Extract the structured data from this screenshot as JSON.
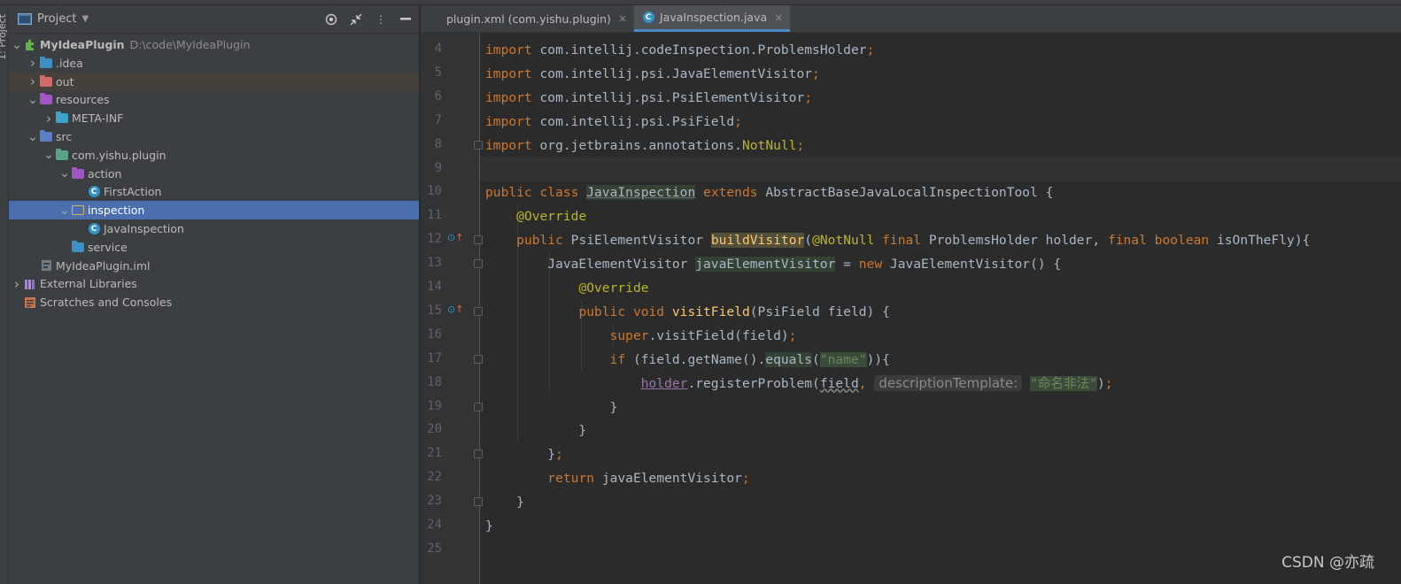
{
  "sidebar_stripe_label": "1: Project",
  "project_panel": {
    "title": "Project",
    "tree": [
      {
        "depth": 0,
        "expanded": true,
        "icon": "plugin-module-icon",
        "label": "MyIdeaPlugin",
        "path": "D:\\code\\MyIdeaPlugin",
        "bold": true
      },
      {
        "depth": 1,
        "expanded": false,
        "icon": "folder-idea-icon",
        "label": ".idea"
      },
      {
        "depth": 1,
        "expanded": false,
        "icon": "folder-out-icon",
        "label": "out",
        "style": "hl-out"
      },
      {
        "depth": 1,
        "expanded": true,
        "icon": "folder-resources-icon",
        "label": "resources"
      },
      {
        "depth": 2,
        "expanded": false,
        "icon": "folder-meta-icon",
        "label": "META-INF"
      },
      {
        "depth": 1,
        "expanded": true,
        "icon": "folder-src-icon",
        "label": "src"
      },
      {
        "depth": 2,
        "expanded": true,
        "icon": "package-icon",
        "label": "com.yishu.plugin"
      },
      {
        "depth": 3,
        "expanded": true,
        "icon": "package-action-icon",
        "label": "action"
      },
      {
        "depth": 4,
        "expanded": null,
        "icon": "class-icon",
        "label": "FirstAction"
      },
      {
        "depth": 3,
        "expanded": true,
        "icon": "folder-plain-icon",
        "label": "inspection",
        "style": "selected"
      },
      {
        "depth": 4,
        "expanded": null,
        "icon": "class-icon",
        "label": "JavaInspection"
      },
      {
        "depth": 3,
        "expanded": null,
        "icon": "package-service-icon",
        "label": "service"
      },
      {
        "depth": 1,
        "expanded": null,
        "icon": "iml-file-icon",
        "label": "MyIdeaPlugin.iml"
      },
      {
        "depth": 0,
        "expanded": false,
        "icon": "library-icon",
        "label": "External Libraries"
      },
      {
        "depth": 0,
        "expanded": null,
        "icon": "scratches-icon",
        "label": "Scratches and Consoles"
      }
    ]
  },
  "tabs": [
    {
      "label": "plugin.xml (com.yishu.plugin)",
      "icon": "plugin-xml-icon",
      "active": false
    },
    {
      "label": "JavaInspection.java",
      "icon": "class-icon",
      "active": true
    }
  ],
  "editor": {
    "lines": [
      {
        "n": "4",
        "tokens": [
          {
            "t": "import ",
            "c": "kw"
          },
          {
            "t": "com.intellij.codeInspection.ProblemsHolder",
            "c": "dim"
          },
          {
            "t": ";",
            "c": "kw"
          }
        ]
      },
      {
        "n": "5",
        "tokens": [
          {
            "t": "import ",
            "c": "kw"
          },
          {
            "t": "com.intellij.psi.JavaElementVisitor",
            "c": "dim"
          },
          {
            "t": ";",
            "c": "kw"
          }
        ]
      },
      {
        "n": "6",
        "tokens": [
          {
            "t": "import ",
            "c": "kw"
          },
          {
            "t": "com.intellij.psi.PsiElementVisitor",
            "c": "dim"
          },
          {
            "t": ";",
            "c": "kw"
          }
        ]
      },
      {
        "n": "7",
        "tokens": [
          {
            "t": "import ",
            "c": "kw"
          },
          {
            "t": "com.intellij.psi.PsiField",
            "c": "dim"
          },
          {
            "t": ";",
            "c": "kw"
          }
        ]
      },
      {
        "n": "8",
        "tokens": [
          {
            "t": "import ",
            "c": "kw"
          },
          {
            "t": "org.jetbrains.annotations.",
            "c": "dim"
          },
          {
            "t": "NotNull",
            "c": "an"
          },
          {
            "t": ";",
            "c": "kw"
          }
        ]
      },
      {
        "n": "9",
        "tokens": []
      },
      {
        "n": "10",
        "tokens": [
          {
            "t": "public class ",
            "c": "kw"
          },
          {
            "t": "JavaInspection",
            "c": "unused"
          },
          {
            "t": " extends ",
            "c": "kw"
          },
          {
            "t": "AbstractBaseJavaLocalInspectionTool {",
            "c": "dim"
          }
        ]
      },
      {
        "n": "11",
        "tokens": [
          {
            "t": "    ",
            "c": "dim"
          },
          {
            "t": "@Override",
            "c": "an"
          }
        ]
      },
      {
        "n": "12",
        "tokens": [
          {
            "t": "    ",
            "c": "dim"
          },
          {
            "t": "public ",
            "c": "kw"
          },
          {
            "t": "PsiElementVisitor ",
            "c": "dim"
          },
          {
            "t": "buildVisitor",
            "c": "fn hlbg2"
          },
          {
            "t": "(",
            "c": "dim"
          },
          {
            "t": "@NotNull ",
            "c": "an"
          },
          {
            "t": "final ",
            "c": "kw"
          },
          {
            "t": "ProblemsHolder holder, ",
            "c": "dim"
          },
          {
            "t": "final boolean ",
            "c": "kw"
          },
          {
            "t": "isOnTheFly){",
            "c": "dim"
          }
        ]
      },
      {
        "n": "13",
        "tokens": [
          {
            "t": "        JavaElementVisitor ",
            "c": "dim"
          },
          {
            "t": "javaElementVisitor",
            "c": "dim hlbg"
          },
          {
            "t": " = ",
            "c": "dim"
          },
          {
            "t": "new ",
            "c": "kw"
          },
          {
            "t": "JavaElementVisitor() {",
            "c": "dim"
          }
        ]
      },
      {
        "n": "14",
        "tokens": [
          {
            "t": "            ",
            "c": "dim"
          },
          {
            "t": "@Override",
            "c": "an"
          }
        ]
      },
      {
        "n": "15",
        "tokens": [
          {
            "t": "            ",
            "c": "dim"
          },
          {
            "t": "public void ",
            "c": "kw"
          },
          {
            "t": "visitField",
            "c": "fn"
          },
          {
            "t": "(PsiField field) {",
            "c": "dim"
          }
        ]
      },
      {
        "n": "16",
        "tokens": [
          {
            "t": "                ",
            "c": "dim"
          },
          {
            "t": "super",
            "c": "kw"
          },
          {
            "t": ".visitField(field)",
            "c": "dim"
          },
          {
            "t": ";",
            "c": "kw"
          }
        ]
      },
      {
        "n": "17",
        "tokens": [
          {
            "t": "                ",
            "c": "dim"
          },
          {
            "t": "if ",
            "c": "kw"
          },
          {
            "t": "(field.getName().",
            "c": "dim"
          },
          {
            "t": "equals",
            "c": "dim hlbg"
          },
          {
            "t": "(",
            "c": "dim"
          },
          {
            "t": "\"name\"",
            "c": "strhl"
          },
          {
            "t": ")){",
            "c": "dim"
          }
        ]
      },
      {
        "n": "18",
        "tokens": [
          {
            "t": "                    ",
            "c": "dim"
          },
          {
            "t": "holder",
            "c": "fld"
          },
          {
            "t": ".registerProblem(",
            "c": "dim"
          },
          {
            "t": "field",
            "c": "dim wavy"
          },
          {
            "t": ", ",
            "c": "kw"
          },
          {
            "t": "descriptionTemplate:",
            "c": "hint"
          },
          {
            "t": " ",
            "c": "dim"
          },
          {
            "t": "\"命名非法\"",
            "c": "strhl"
          },
          {
            "t": ")",
            "c": "dim"
          },
          {
            "t": ";",
            "c": "kw"
          }
        ]
      },
      {
        "n": "19",
        "tokens": [
          {
            "t": "                }",
            "c": "dim"
          }
        ]
      },
      {
        "n": "20",
        "tokens": [
          {
            "t": "            }",
            "c": "dim"
          }
        ]
      },
      {
        "n": "21",
        "tokens": [
          {
            "t": "        }",
            "c": "dim"
          },
          {
            "t": ";",
            "c": "kw"
          }
        ]
      },
      {
        "n": "22",
        "tokens": [
          {
            "t": "        ",
            "c": "dim"
          },
          {
            "t": "return ",
            "c": "kw"
          },
          {
            "t": "javaElementVisitor",
            "c": "dim"
          },
          {
            "t": ";",
            "c": "kw"
          }
        ]
      },
      {
        "n": "23",
        "tokens": [
          {
            "t": "    }",
            "c": "dim"
          }
        ]
      },
      {
        "n": "24",
        "tokens": [
          {
            "t": "}",
            "c": "dim"
          }
        ]
      },
      {
        "n": "25",
        "tokens": []
      }
    ],
    "override_markers": [
      "12",
      "15"
    ],
    "fold_markers": [
      "8",
      "12",
      "13",
      "15",
      "17",
      "19",
      "21",
      "23"
    ]
  },
  "watermark": "CSDN @亦疏"
}
